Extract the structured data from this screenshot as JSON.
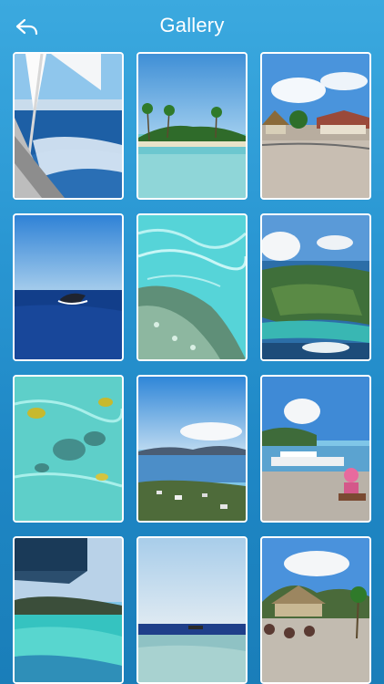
{
  "header": {
    "title": "Gallery",
    "back_icon": "back-arrow-icon"
  },
  "colors": {
    "background_top": "#3ba9df",
    "background_bottom": "#1a7eb9",
    "thumb_border": "#ffffff"
  },
  "gallery": {
    "photos": [
      {
        "subject": "sailboat-on-ocean"
      },
      {
        "subject": "palm-island-lagoon"
      },
      {
        "subject": "thatched-huts-beach"
      },
      {
        "subject": "whale-breaching"
      },
      {
        "subject": "turquoise-reef-water"
      },
      {
        "subject": "aerial-island-coast"
      },
      {
        "subject": "tropical-fish-shallows"
      },
      {
        "subject": "coastal-town-view"
      },
      {
        "subject": "harbor-boats-dock"
      },
      {
        "subject": "aerial-lagoon-mountains"
      },
      {
        "subject": "calm-sea-horizon"
      },
      {
        "subject": "thatched-hut-hill"
      }
    ]
  }
}
